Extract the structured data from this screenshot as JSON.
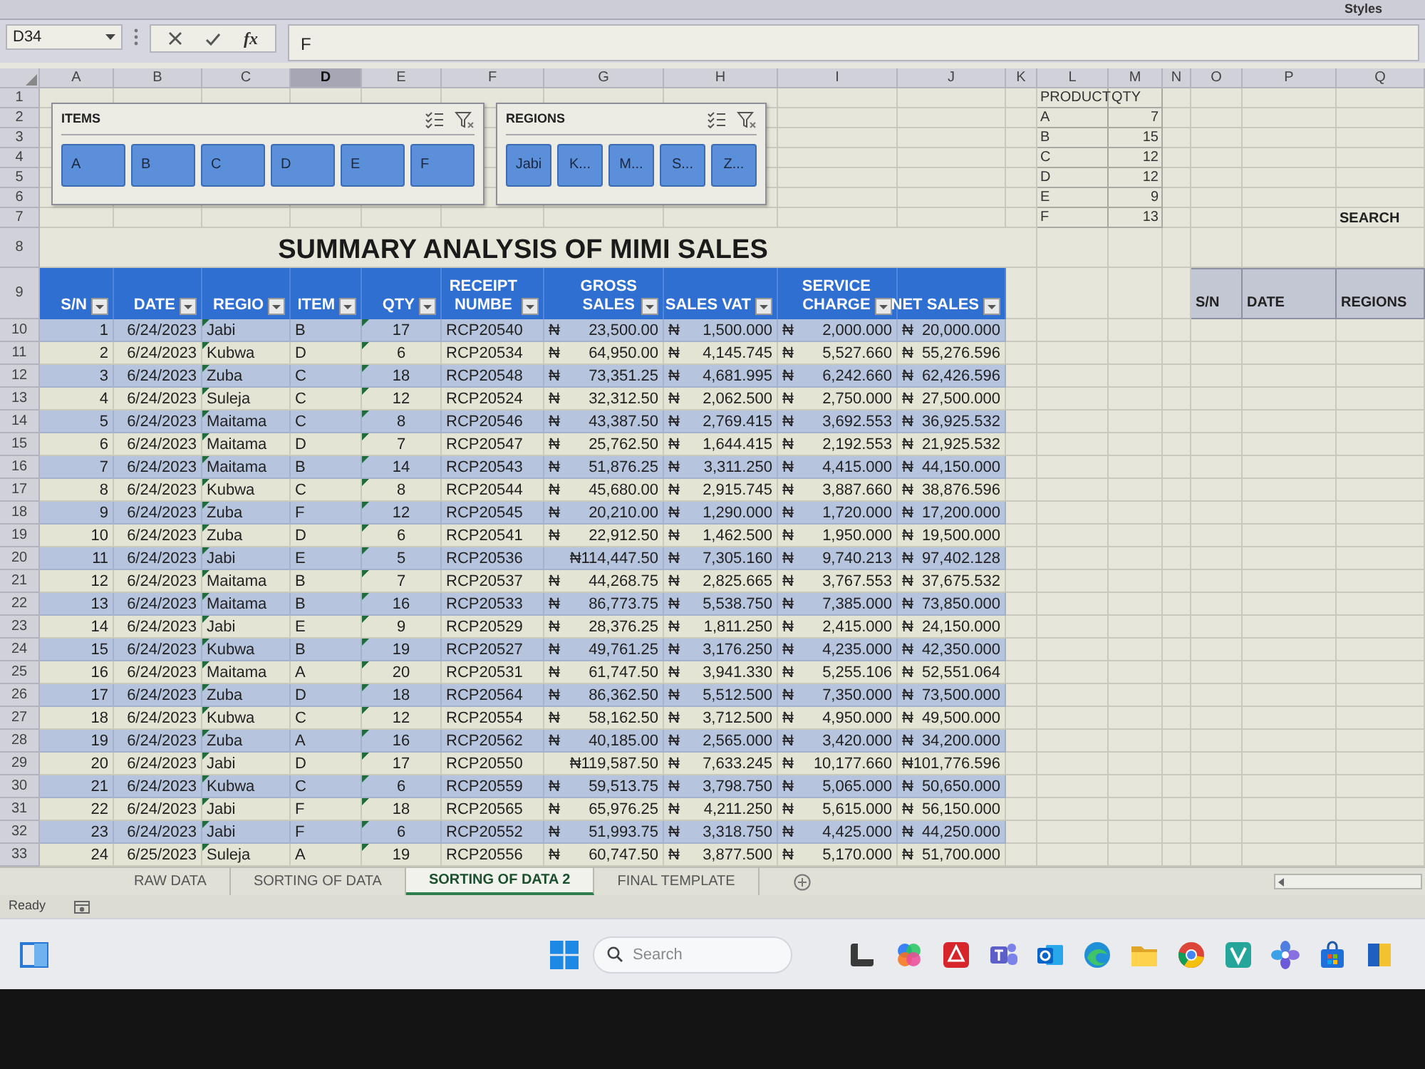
{
  "ribbon": {
    "group_label": "Styles"
  },
  "formula_bar": {
    "name_box": "D34",
    "function_label": "fx",
    "formula": "F"
  },
  "column_headers": [
    {
      "label": "A",
      "selected": false
    },
    {
      "label": "B",
      "selected": false
    },
    {
      "label": "C",
      "selected": false
    },
    {
      "label": "D",
      "selected": true
    },
    {
      "label": "E",
      "selected": false
    },
    {
      "label": "F",
      "selected": false
    },
    {
      "label": "G",
      "selected": false
    },
    {
      "label": "H",
      "selected": false
    },
    {
      "label": "I",
      "selected": false
    },
    {
      "label": "J",
      "selected": false
    },
    {
      "label": "K",
      "selected": false
    },
    {
      "label": "L",
      "selected": false
    },
    {
      "label": "M",
      "selected": false
    },
    {
      "label": "N",
      "selected": false
    },
    {
      "label": "O",
      "selected": false
    },
    {
      "label": "P",
      "selected": false
    },
    {
      "label": "Q",
      "selected": false
    }
  ],
  "row_numbers": [
    "1",
    "2",
    "3",
    "4",
    "5",
    "6",
    "7",
    "8",
    "9",
    "10",
    "11",
    "12",
    "13",
    "14",
    "15",
    "16",
    "17",
    "18",
    "19",
    "20",
    "21",
    "22",
    "23",
    "24",
    "25",
    "26",
    "27",
    "28",
    "29",
    "30",
    "31",
    "32",
    "33"
  ],
  "slicers": [
    {
      "title": "ITEMS",
      "buttons": [
        {
          "label": "A",
          "selected": true
        },
        {
          "label": "B",
          "selected": true
        },
        {
          "label": "C",
          "selected": true
        },
        {
          "label": "D",
          "selected": true
        },
        {
          "label": "E",
          "selected": true
        },
        {
          "label": "F",
          "selected": true
        }
      ]
    },
    {
      "title": "REGIONS",
      "buttons": [
        {
          "label": "Jabi",
          "selected": true
        },
        {
          "label": "K...",
          "selected": true
        },
        {
          "label": "M...",
          "selected": true
        },
        {
          "label": "S...",
          "selected": true
        },
        {
          "label": "Z...",
          "selected": true
        }
      ]
    }
  ],
  "product_table": {
    "columns": [
      "PRODUCT",
      "QTY"
    ],
    "rows": [
      [
        "A",
        "7"
      ],
      [
        "B",
        "15"
      ],
      [
        "C",
        "12"
      ],
      [
        "D",
        "12"
      ],
      [
        "E",
        "9"
      ],
      [
        "F",
        "13"
      ]
    ]
  },
  "search_label": "SEARCH",
  "title": "SUMMARY ANALYSIS OF MIMI SALES",
  "search_table": {
    "columns": [
      "S/N",
      "DATE",
      "REGIONS"
    ]
  },
  "table": {
    "columns": [
      "S/N",
      "DATE",
      "REGIO",
      "ITEM",
      "QTY",
      "RECEIPT NUMBE",
      "GROSS SALES",
      "SALES VAT",
      "SERVICE CHARGE",
      "NET SALES"
    ],
    "rows": [
      {
        "cells": [
          "1",
          "6/24/2023",
          "Jabi",
          "B",
          "17",
          "RCP20540",
          "₦ 23,500.00",
          "₦ 1,500.000",
          "₦ 2,000.000",
          "₦ 20,000.000"
        ],
        "flagged": true
      },
      {
        "cells": [
          "2",
          "6/24/2023",
          "Kubwa",
          "D",
          "6",
          "RCP20534",
          "₦ 64,950.00",
          "₦ 4,145.745",
          "₦ 5,527.660",
          "₦ 55,276.596"
        ],
        "flagged": true
      },
      {
        "cells": [
          "3",
          "6/24/2023",
          "Zuba",
          "C",
          "18",
          "RCP20548",
          "₦ 73,351.25",
          "₦ 4,681.995",
          "₦ 6,242.660",
          "₦ 62,426.596"
        ],
        "flagged": true
      },
      {
        "cells": [
          "4",
          "6/24/2023",
          "Suleja",
          "C",
          "12",
          "RCP20524",
          "₦ 32,312.50",
          "₦ 2,062.500",
          "₦ 2,750.000",
          "₦ 27,500.000"
        ],
        "flagged": true
      },
      {
        "cells": [
          "5",
          "6/24/2023",
          "Maitama",
          "C",
          "8",
          "RCP20546",
          "₦ 43,387.50",
          "₦ 2,769.415",
          "₦ 3,692.553",
          "₦ 36,925.532"
        ],
        "flagged": true
      },
      {
        "cells": [
          "6",
          "6/24/2023",
          "Maitama",
          "D",
          "7",
          "RCP20547",
          "₦ 25,762.50",
          "₦ 1,644.415",
          "₦ 2,192.553",
          "₦ 21,925.532"
        ],
        "flagged": true
      },
      {
        "cells": [
          "7",
          "6/24/2023",
          "Maitama",
          "B",
          "14",
          "RCP20543",
          "₦ 51,876.25",
          "₦ 3,311.250",
          "₦ 4,415.000",
          "₦ 44,150.000"
        ],
        "flagged": true
      },
      {
        "cells": [
          "8",
          "6/24/2023",
          "Kubwa",
          "C",
          "8",
          "RCP20544",
          "₦ 45,680.00",
          "₦ 2,915.745",
          "₦ 3,887.660",
          "₦ 38,876.596"
        ],
        "flagged": true
      },
      {
        "cells": [
          "9",
          "6/24/2023",
          "Zuba",
          "F",
          "12",
          "RCP20545",
          "₦ 20,210.00",
          "₦ 1,290.000",
          "₦ 1,720.000",
          "₦ 17,200.000"
        ],
        "flagged": true
      },
      {
        "cells": [
          "10",
          "6/24/2023",
          "Zuba",
          "D",
          "6",
          "RCP20541",
          "₦ 22,912.50",
          "₦ 1,462.500",
          "₦ 1,950.000",
          "₦ 19,500.000"
        ],
        "flagged": true
      },
      {
        "cells": [
          "11",
          "6/24/2023",
          "Jabi",
          "E",
          "5",
          "RCP20536",
          "₦114,447.50",
          "₦ 7,305.160",
          "₦ 9,740.213",
          "₦ 97,402.128"
        ],
        "flagged": true
      },
      {
        "cells": [
          "12",
          "6/24/2023",
          "Maitama",
          "B",
          "7",
          "RCP20537",
          "₦ 44,268.75",
          "₦ 2,825.665",
          "₦ 3,767.553",
          "₦ 37,675.532"
        ],
        "flagged": true
      },
      {
        "cells": [
          "13",
          "6/24/2023",
          "Maitama",
          "B",
          "16",
          "RCP20533",
          "₦ 86,773.75",
          "₦ 5,538.750",
          "₦ 7,385.000",
          "₦ 73,850.000"
        ],
        "flagged": true
      },
      {
        "cells": [
          "14",
          "6/24/2023",
          "Jabi",
          "E",
          "9",
          "RCP20529",
          "₦ 28,376.25",
          "₦ 1,811.250",
          "₦ 2,415.000",
          "₦ 24,150.000"
        ],
        "flagged": true
      },
      {
        "cells": [
          "15",
          "6/24/2023",
          "Kubwa",
          "B",
          "19",
          "RCP20527",
          "₦ 49,761.25",
          "₦ 3,176.250",
          "₦ 4,235.000",
          "₦ 42,350.000"
        ],
        "flagged": true
      },
      {
        "cells": [
          "16",
          "6/24/2023",
          "Maitama",
          "A",
          "20",
          "RCP20531",
          "₦ 61,747.50",
          "₦ 3,941.330",
          "₦ 5,255.106",
          "₦ 52,551.064"
        ],
        "flagged": true
      },
      {
        "cells": [
          "17",
          "6/24/2023",
          "Zuba",
          "D",
          "18",
          "RCP20564",
          "₦ 86,362.50",
          "₦ 5,512.500",
          "₦ 7,350.000",
          "₦ 73,500.000"
        ],
        "flagged": true
      },
      {
        "cells": [
          "18",
          "6/24/2023",
          "Kubwa",
          "C",
          "12",
          "RCP20554",
          "₦ 58,162.50",
          "₦ 3,712.500",
          "₦ 4,950.000",
          "₦ 49,500.000"
        ],
        "flagged": true
      },
      {
        "cells": [
          "19",
          "6/24/2023",
          "Zuba",
          "A",
          "16",
          "RCP20562",
          "₦ 40,185.00",
          "₦ 2,565.000",
          "₦ 3,420.000",
          "₦ 34,200.000"
        ],
        "flagged": true
      },
      {
        "cells": [
          "20",
          "6/24/2023",
          "Jabi",
          "D",
          "17",
          "RCP20550",
          "₦119,587.50",
          "₦ 7,633.245",
          "₦ 10,177.660",
          "₦101,776.596"
        ],
        "flagged": true
      },
      {
        "cells": [
          "21",
          "6/24/2023",
          "Kubwa",
          "C",
          "6",
          "RCP20559",
          "₦ 59,513.75",
          "₦ 3,798.750",
          "₦ 5,065.000",
          "₦ 50,650.000"
        ],
        "flagged": true
      },
      {
        "cells": [
          "22",
          "6/24/2023",
          "Jabi",
          "F",
          "18",
          "RCP20565",
          "₦ 65,976.25",
          "₦ 4,211.250",
          "₦ 5,615.000",
          "₦ 56,150.000"
        ],
        "flagged": true
      },
      {
        "cells": [
          "23",
          "6/24/2023",
          "Jabi",
          "F",
          "6",
          "RCP20552",
          "₦ 51,993.75",
          "₦ 3,318.750",
          "₦ 4,425.000",
          "₦ 44,250.000"
        ],
        "flagged": true
      },
      {
        "cells": [
          "24",
          "6/25/2023",
          "Suleja",
          "A",
          "19",
          "RCP20556",
          "₦ 60,747.50",
          "₦ 3,877.500",
          "₦ 5,170.000",
          "₦ 51,700.000"
        ],
        "flagged": true
      }
    ]
  },
  "sheet_tabs": [
    {
      "label": "RAW DATA",
      "selected": false
    },
    {
      "label": "SORTING OF DATA",
      "selected": false
    },
    {
      "label": "SORTING OF DATA 2",
      "selected": true
    },
    {
      "label": "FINAL TEMPLATE",
      "selected": false
    }
  ],
  "status_bar": {
    "text": "Ready"
  },
  "taskbar": {
    "search": {
      "placeholder": "Search"
    }
  }
}
